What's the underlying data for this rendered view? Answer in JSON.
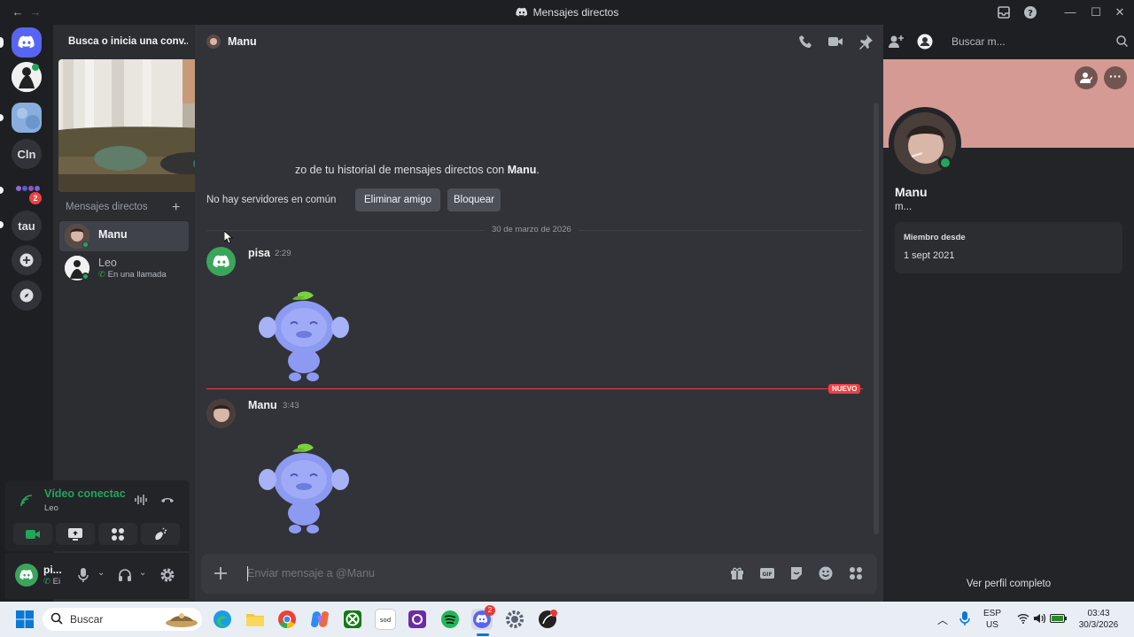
{
  "window": {
    "title": "Mensajes directos"
  },
  "servers": {
    "items": [
      "Cln",
      "tau"
    ],
    "badge": "2"
  },
  "dm_sidebar": {
    "search_label": "Busca o inicia una conv...",
    "section_title": "Mensajes directos",
    "items": [
      {
        "name": "Manu",
        "sub": ""
      },
      {
        "name": "Leo",
        "sub": "En una llamada"
      }
    ]
  },
  "voice": {
    "status": "Vídeo conectac",
    "channel": "Leo"
  },
  "user": {
    "name": "pi...",
    "status": "Ei"
  },
  "chat": {
    "header_name": "Manu",
    "search_placeholder": "Buscar m...",
    "intro_text": "zo de tu historial de mensajes directos con ",
    "intro_name": "Manu",
    "intro_end": ".",
    "no_servers": "No hay servidores en común",
    "remove_friend": "Eliminar amigo",
    "block": "Bloquear",
    "date_divider": "30 de marzo de 2026",
    "new_label": "NUEVO",
    "messages": [
      {
        "author": "pisa",
        "time": "2:29"
      },
      {
        "author": "Manu",
        "time": "3:43"
      }
    ],
    "composer_placeholder": "Enviar mensaje a @Manu"
  },
  "profile": {
    "display_name": "Manu",
    "username": "m...",
    "member_since_label": "Miembro desde",
    "member_since": "1 sept 2021",
    "full_profile": "Ver perfil completo",
    "banner_color": "#d49a93"
  },
  "taskbar": {
    "search": "Buscar",
    "lang1": "ESP",
    "lang2": "US",
    "time": "03:43",
    "date": "30/3/2026",
    "discord_badge": "2"
  },
  "colors": {
    "accent": "#5865f2",
    "online": "#23a55a",
    "danger": "#f23f43"
  }
}
